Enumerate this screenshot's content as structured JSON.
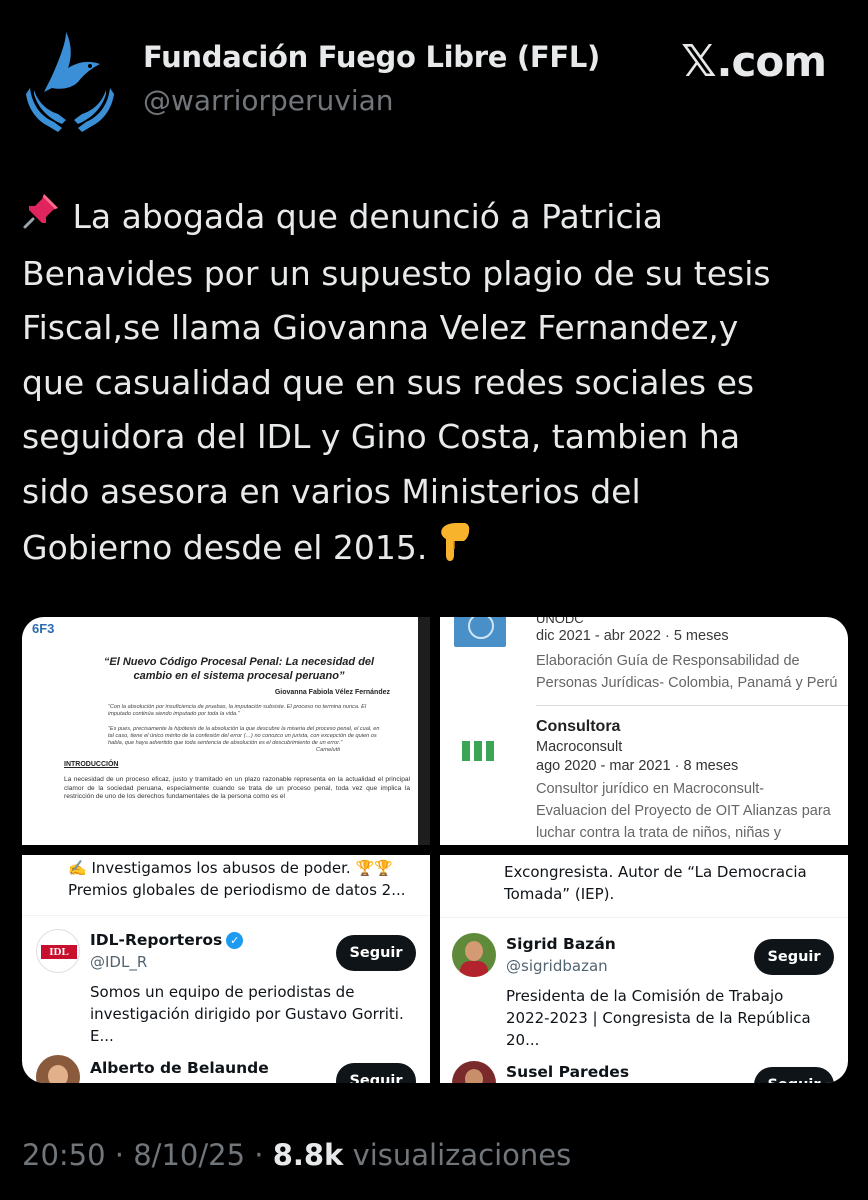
{
  "author": {
    "name": "Fundación Fuego Libre (FFL)",
    "handle": "@warriorperuvian",
    "avatar_icon": "dove-hands-icon"
  },
  "brand": {
    "label": ".com",
    "icon": "x-logo-icon"
  },
  "tweet": {
    "lead_icon": "pushpin-emoji",
    "text": "La abogada que denunció a Patricia\nBenavides por un supuesto plagio de su tesis\nFiscal,se llama Giovanna Velez Fernandez,y\nque casualidad que en sus redes sociales es\nseguidora del IDL y Gino Costa, tambien ha\nsido asesora en varios Ministerios del\nGobierno desde el 2015. ",
    "trail_icon": "pointing-down-emoji"
  },
  "media": {
    "document": {
      "tag": "6F3",
      "title_line1": "“El Nuevo Código Procesal Penal: La necesidad del",
      "title_line2": "cambio en el sistema procesal peruano”",
      "author": "Giovanna Fabiola Vélez Fernández",
      "quote1": "“Con la absolución por insuficiencia de pruebas, la imputación subsiste. El proceso no termina nunca. El imputado continúa siendo imputado por toda la vida.”",
      "quote2": "“Es pues, precisamente la hipótesis de la absolución la que descubre la miseria del proceso penal, el cual, en tal caso, tiene el único mérito de la confesión del error (…) no conozco un jurista, con excepción de quien os habla, que haya advertido que toda sentencia de absolución es el descubrimiento de un error.”",
      "signature": "Carnelutti",
      "intro_heading": "INTRODUCCIÓN",
      "paragraph": "La necesidad de un proceso eficaz, justo y tramitado en un plazo razonable representa en la actualidad el principal clamor de la sociedad peruana, especialmente cuando se trata de un proceso penal, toda vez que implica la restricción de uno de los derechos fundamentales de la persona como es el"
    },
    "experience": {
      "org1": "UNODC",
      "org1_dates": "dic 2021 - abr 2022 · 5 meses",
      "org1_desc1": "Elaboración Guía de Responsabilidad de",
      "org1_desc2": "Personas Jurídicas- Colombia, Panamá y Perú",
      "role2": "Consultora",
      "org2": "Macroconsult",
      "org2_dates": "ago 2020 - mar 2021 · 8 meses",
      "org2_desc1": "Consultor jurídico en Macroconsult-",
      "org2_desc2": "Evaluacion del Proyecto de OIT Alianzas para",
      "org2_desc3": "luchar contra la trata de niños, niñas y"
    },
    "follows_left": {
      "top_line1": "✍️ Investigamos los abusos de poder. 🏆🏆",
      "top_line2": "Premios globales de periodismo de datos 2...",
      "account1_name": "IDL-Reporteros",
      "account1_handle": "@IDL_R",
      "account1_bio1": "Somos un equipo de periodistas de",
      "account1_bio2": "investigación dirigido por Gustavo Gorriti. E...",
      "account1_logo": "IDL",
      "account1_follow": "Seguir",
      "account2_name": "Alberto de Belaunde",
      "account2_follow": "Seguir"
    },
    "follows_right": {
      "top_line1": "Excongresista. Autor de “La Democracia",
      "top_line2": "Tomada” (IEP).",
      "account1_name": "Sigrid Bazán",
      "account1_handle": "@sigridbazan",
      "account1_bio1": "Presidenta de la Comisión de Trabajo",
      "account1_bio2": "2022-2023 | Congresista de la República 20...",
      "account1_follow": "Seguir",
      "account2_name": "Susel Paredes",
      "account2_follow": "Seguir"
    }
  },
  "footer": {
    "time": "20:50",
    "date": "8/10/25",
    "views_count": "8.8k",
    "views_label": "visualizaciones",
    "separator": "·"
  },
  "colors": {
    "background": "#000000",
    "primary_text": "#e7e9ea",
    "secondary_text": "#71767b",
    "avatar_blue": "#3a8fd6",
    "linkedin_green": "#3aa655",
    "verified_blue": "#1d9bf0"
  }
}
